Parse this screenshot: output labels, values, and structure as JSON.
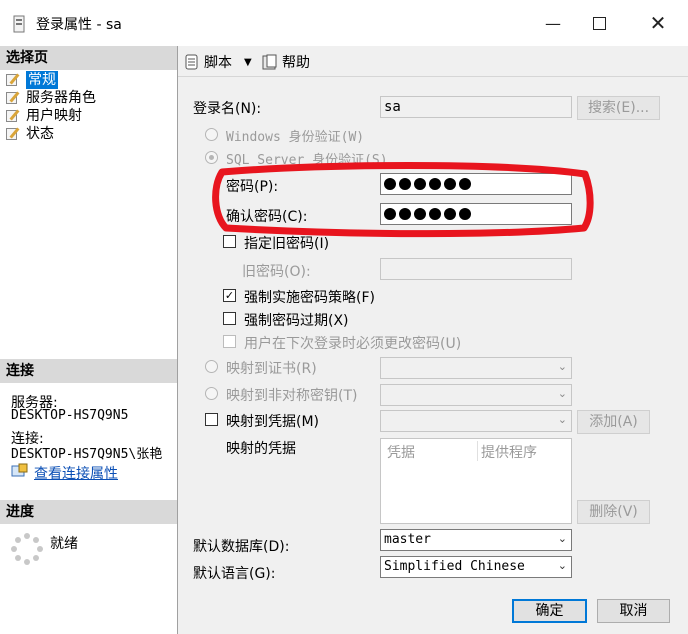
{
  "window": {
    "title": "登录属性 - sa",
    "minimize_icon": "minimize-icon",
    "maximize_icon": "maximize-icon",
    "close_icon": "close-icon"
  },
  "left": {
    "select_page_header": "选择页",
    "nav": [
      "常规",
      "服务器角色",
      "用户映射",
      "状态"
    ],
    "connection_header": "连接",
    "server_label": "服务器:",
    "server_value": "DESKTOP-HS7Q9N5",
    "connection_label": "连接:",
    "connection_value": "DESKTOP-HS7Q9N5\\张艳",
    "view_connection_link": "查看连接属性",
    "progress_header": "进度",
    "progress_status": "就绪"
  },
  "toolbar": {
    "script_label": "脚本",
    "help_label": "帮助"
  },
  "form": {
    "login_name_label": "登录名(N):",
    "login_name_value": "sa",
    "search_button": "搜索(E)...",
    "windows_auth_label": "Windows 身份验证(W)",
    "sql_auth_label": "SQL Server 身份验证(S)",
    "password_label": "密码(P):",
    "password_dots": 6,
    "confirm_password_label": "确认密码(C):",
    "confirm_password_dots": 6,
    "specify_old_password_label": "指定旧密码(I)",
    "old_password_label": "旧密码(O):",
    "enforce_policy_label": "强制实施密码策略(F)",
    "enforce_policy_checked": true,
    "enforce_expiration_label": "强制密码过期(X)",
    "must_change_label": "用户在下次登录时必须更改密码(U)",
    "map_cert_label": "映射到证书(R)",
    "map_asym_key_label": "映射到非对称密钥(T)",
    "map_credential_label": "映射到凭据(M)",
    "add_button": "添加(A)",
    "mapped_credentials_label": "映射的凭据",
    "cred_columns": [
      "凭据",
      "提供程序"
    ],
    "remove_button": "删除(V)",
    "default_db_label": "默认数据库(D):",
    "default_db_value": "master",
    "default_lang_label": "默认语言(G):",
    "default_lang_value": "Simplified Chinese"
  },
  "footer": {
    "ok_button": "确定",
    "cancel_button": "取消"
  },
  "annotation": {
    "color": "#e8151e"
  }
}
